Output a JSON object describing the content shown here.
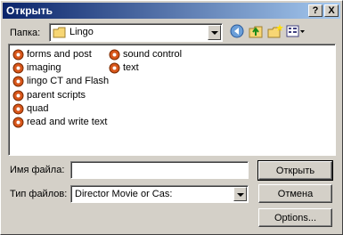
{
  "window": {
    "title": "Открыть",
    "help_label": "?",
    "close_label": "X"
  },
  "lookin": {
    "label": "Папка:",
    "value": "Lingo"
  },
  "toolbar": {
    "icons": [
      "back-icon",
      "up-folder-icon",
      "new-folder-icon",
      "view-menu-icon"
    ]
  },
  "files": [
    {
      "label": "forms and post"
    },
    {
      "label": "imaging"
    },
    {
      "label": "lingo CT and Flash"
    },
    {
      "label": "parent scripts"
    },
    {
      "label": "quad"
    },
    {
      "label": "read and write text"
    },
    {
      "label": "sound control"
    },
    {
      "label": "text"
    }
  ],
  "filename": {
    "label": "Имя файла:",
    "value": ""
  },
  "filetype": {
    "label": "Тип файлов:",
    "value": "Director Movie or Cas:"
  },
  "buttons": {
    "open": "Открыть",
    "cancel": "Отмена",
    "options": "Options..."
  },
  "colors": {
    "title_start": "#0a246a",
    "title_end": "#a6caf0",
    "face": "#d4d0c8"
  }
}
